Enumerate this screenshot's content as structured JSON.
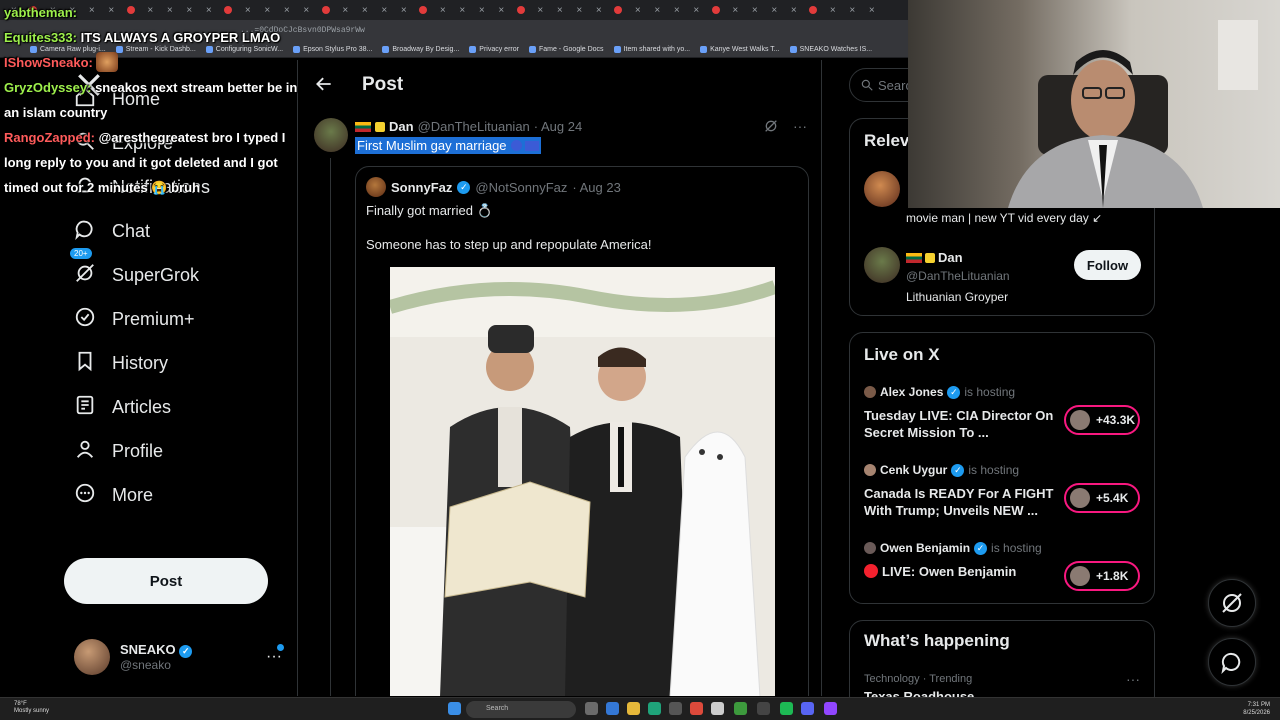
{
  "browser": {
    "url": "...=0CdDoCJcBsvn0DPWsa9rWw",
    "tab_glyph": "×",
    "bookmarks": [
      "Camera Raw plug-i...",
      "Stream - Kick Dashb...",
      "Configuring SonicW...",
      "Epson Stylus Pro 38...",
      "Broadway By Desig...",
      "Privacy error",
      "Fame - Google Docs",
      "Item shared with yo...",
      "Kanye West Walks T...",
      "SNEAKO Watches IS..."
    ]
  },
  "nav": {
    "items": [
      {
        "label": "Home",
        "icon": "home-icon"
      },
      {
        "label": "Explore",
        "icon": "search-icon"
      },
      {
        "label": "Notifications",
        "icon": "bell-icon"
      },
      {
        "label": "Chat",
        "icon": "chat-icon"
      },
      {
        "label": "SuperGrok",
        "icon": "grok-icon"
      },
      {
        "label": "Premium+",
        "icon": "verified-badge-icon"
      },
      {
        "label": "History",
        "icon": "bookmark-icon"
      },
      {
        "label": "Articles",
        "icon": "articles-icon"
      },
      {
        "label": "Profile",
        "icon": "person-icon"
      },
      {
        "label": "More",
        "icon": "more-circle-icon"
      }
    ],
    "chat_badge": "20+",
    "post_button": "Post",
    "account": {
      "name": "SNEAKO",
      "handle": "@sneako",
      "more": "···"
    }
  },
  "main": {
    "title": "Post",
    "post": {
      "name": "Dan",
      "handle": "@DanTheLituanian",
      "date": "· Aug 24",
      "text": "First Muslim gay marriage"
    },
    "quote": {
      "name": "SonnyFaz",
      "handle": "@NotSonnyFaz",
      "date": "· Aug 23",
      "line1": "Finally got married 💍",
      "line2": "Someone has to step up and repopulate America!"
    }
  },
  "right": {
    "search_placeholder": "Search",
    "relevant": {
      "title": "Relevant people",
      "user1_bio": "movie man | new YT vid every day ↙",
      "user2": {
        "name": "Dan",
        "handle": "@DanTheLituanian",
        "bio": "Lithuanian Groyper",
        "follow": "Follow"
      }
    },
    "live": {
      "title": "Live on X",
      "items": [
        {
          "host": "Alex Jones",
          "status": "is hosting",
          "title": "Tuesday LIVE: CIA Director On Secret Mission To ...",
          "count": "+43.3K"
        },
        {
          "host": "Cenk Uygur",
          "status": "is hosting",
          "title": "Canada Is READY For A FIGHT With Trump; Unveils NEW ...",
          "count": "+5.4K"
        },
        {
          "host": "Owen Benjamin",
          "status": "is hosting",
          "title": "LIVE: Owen Benjamin",
          "count": "+1.8K"
        }
      ]
    },
    "happening": {
      "title": "What’s happening",
      "sub": "Technology · Trending",
      "topic": "Texas Roadhouse",
      "more": "···"
    }
  },
  "chat": {
    "messages": [
      {
        "user": "yabtheman:",
        "text": ""
      },
      {
        "user": "Equites333:",
        "text": "ITS ALWAYS A GROYPER LMAO"
      },
      {
        "user": "IShowSneako:",
        "text": ""
      },
      {
        "user": "GryzOdyssey:",
        "text": "sneakos next stream better be in an islam country"
      },
      {
        "user": "RangoZapped:",
        "text": "@aresthegreatest bro I typed I long reply to you and it got deleted and I got timed out for 2 minutes 😭 bruh"
      }
    ]
  },
  "taskbar": {
    "temp": "78°F",
    "weather": "Mostly sunny",
    "search": "Search",
    "time": "7:31 PM",
    "date": "8/25/2026"
  }
}
